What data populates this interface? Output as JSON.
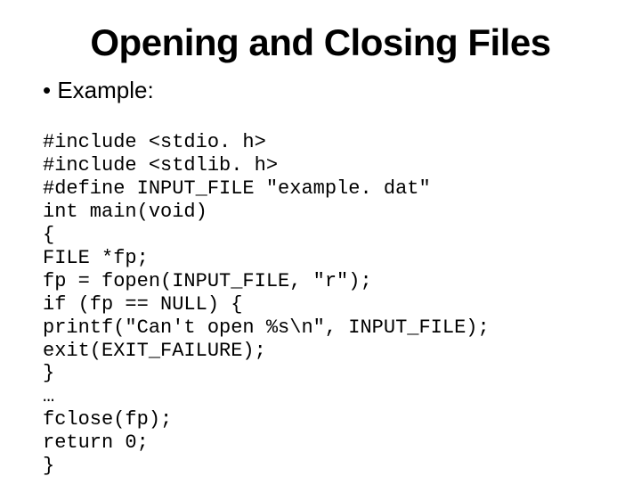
{
  "title": "Opening and Closing Files",
  "bullet": "• Example:",
  "code": {
    "l1": "#include <stdio. h>",
    "l2": "#include <stdlib. h>",
    "l3": "#define INPUT_FILE \"example. dat\"",
    "l4": "int main(void)",
    "l5": "{",
    "l6": "FILE *fp;",
    "l7": "fp = fopen(INPUT_FILE, \"r\");",
    "l8": "if (fp == NULL) {",
    "l9": "printf(\"Can't open %s\\n\", INPUT_FILE);",
    "l10": "exit(EXIT_FAILURE);",
    "l11": "}",
    "l12": "…",
    "l13": "fclose(fp);",
    "l14": "return 0;",
    "l15": "}"
  }
}
